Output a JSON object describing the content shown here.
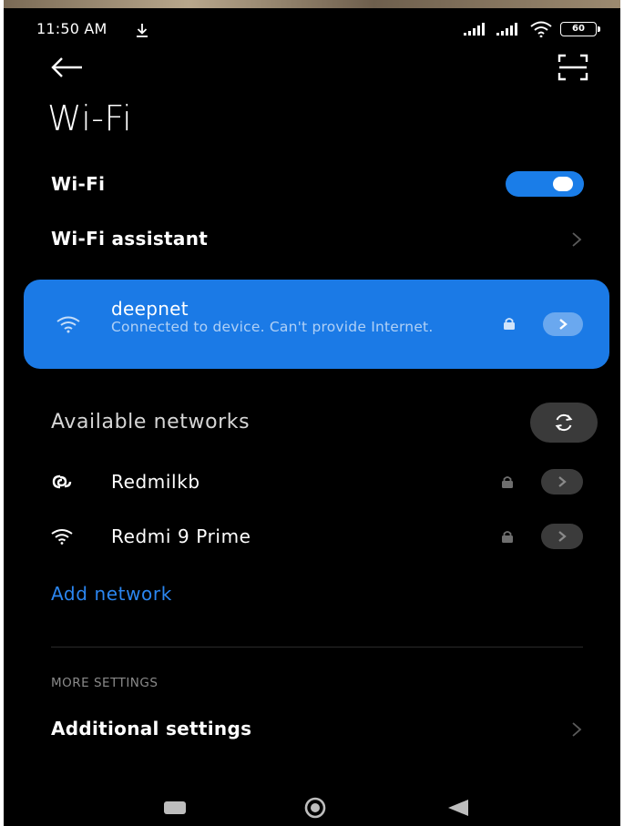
{
  "status_bar": {
    "time": "11:50 AM",
    "download_icon": "download-arrow-icon",
    "signal_icons": [
      "signal-icon",
      "signal-icon"
    ],
    "wifi_icon": "wifi-icon",
    "battery_level": "60"
  },
  "header": {
    "back_icon": "arrow-left-icon",
    "scan_icon": "scan-icon",
    "title": "Wi-Fi"
  },
  "wifi_toggle": {
    "label": "Wi-Fi",
    "enabled": true,
    "accent_color": "#1a7de8"
  },
  "assistant": {
    "label": "Wi-Fi assistant"
  },
  "connected_network": {
    "name": "deepnet",
    "status": "Connected to device. Can't provide Internet.",
    "secured": true,
    "card_color": "#1b7ae6"
  },
  "available": {
    "title": "Available networks",
    "refresh_icon": "refresh-icon",
    "networks": [
      {
        "name": "Redmilkb",
        "icon": "hotspot-link-icon",
        "secured": true
      },
      {
        "name": "Redmi 9 Prime",
        "icon": "wifi-icon",
        "secured": true
      }
    ],
    "add_label": "Add network",
    "add_color": "#2b86f0"
  },
  "more_settings": {
    "caption": "MORE SETTINGS",
    "additional_label": "Additional settings"
  },
  "nav_bar": {
    "recents_icon": "recents-square-icon",
    "home_icon": "home-circle-icon",
    "back_icon": "back-triangle-icon"
  }
}
